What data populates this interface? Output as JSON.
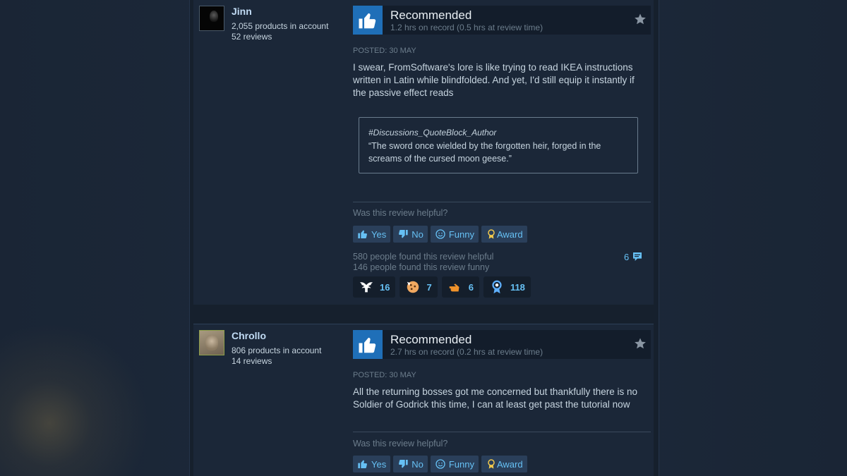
{
  "colors": {
    "accent_blue": "#66c0f4",
    "thumb_blue": "#1f6fb8",
    "page_bg": "#1b2838"
  },
  "reviews": [
    {
      "author": "Jinn",
      "products": "2,055 products in account",
      "reviews": "52 reviews",
      "vote": "Recommended",
      "hours": "1.2 hrs on record (0.5 hrs at review time)",
      "posted": "POSTED: 30 MAY",
      "text": "I swear, FromSoftware's lore is like trying to read IKEA instructions written in Latin while blindfolded. And yet, I'd still equip it instantly if the passive effect reads",
      "quote": {
        "author": "#Discussions_QuoteBlock_Author",
        "body": "“The sword once wielded by the forgotten heir, forged in the screams of the cursed moon geese.”"
      },
      "helpful_question": "Was this review helpful?",
      "buttons": {
        "yes": "Yes",
        "no": "No",
        "funny": "Funny",
        "award": "Award"
      },
      "helpful_count": "580 people found this review helpful",
      "funny_count": "146 people found this review funny",
      "comment_count": "6",
      "awards": [
        {
          "icon": "wings-award-icon",
          "count": "16"
        },
        {
          "icon": "cookie-award-icon",
          "count": "7"
        },
        {
          "icon": "pointing-hand-award-icon",
          "count": "6"
        },
        {
          "icon": "ribbon-award-icon",
          "count": "118"
        }
      ]
    },
    {
      "author": "Chrollo",
      "products": "806 products in account",
      "reviews": "14 reviews",
      "vote": "Recommended",
      "hours": "2.7 hrs on record (0.2 hrs at review time)",
      "posted": "POSTED: 30 MAY",
      "text": "All the returning bosses got me concerned but thankfully there is no Soldier of Godrick this time, I can at least get past the tutorial now",
      "helpful_question": "Was this review helpful?",
      "buttons": {
        "yes": "Yes",
        "no": "No",
        "funny": "Funny",
        "award": "Award"
      }
    }
  ]
}
